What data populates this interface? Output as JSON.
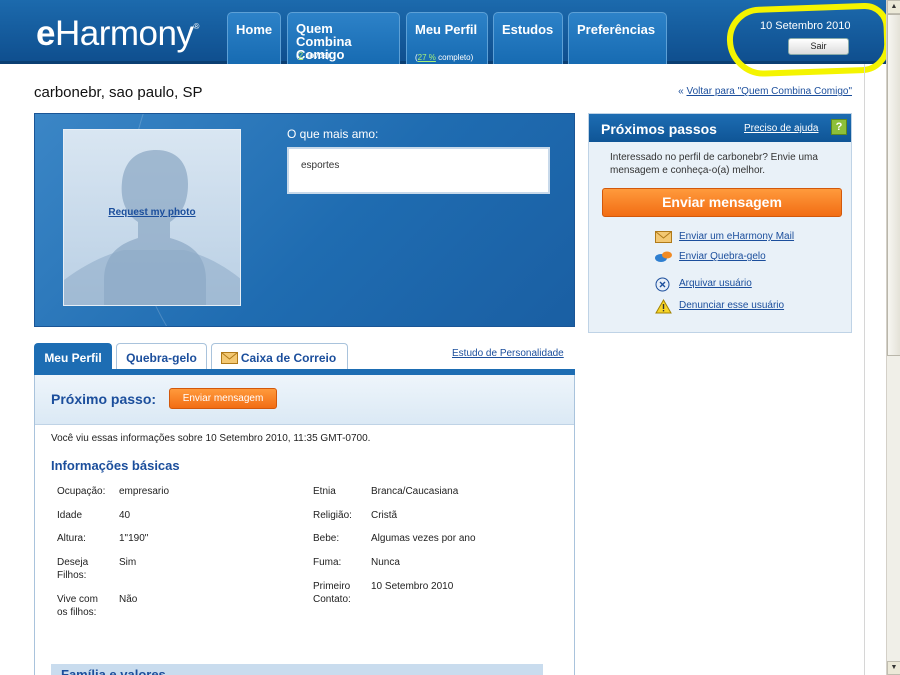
{
  "header": {
    "logo": {
      "e": "e",
      "rest": "Harmony",
      "tm": "®"
    },
    "nav": [
      {
        "label": "Home"
      },
      {
        "label": "Quem Combina Comigo",
        "sub_count": "2",
        "sub_text": " novos)"
      },
      {
        "label": "Meu Perfil",
        "sub_count": "27 %",
        "sub_text": " completo)"
      },
      {
        "label": "Estudos"
      },
      {
        "label": "Preferências"
      }
    ],
    "date": "10 Setembro 2010",
    "logout": "Sair"
  },
  "profile": {
    "title": "carbonebr, sao paulo, SP",
    "back_link_prefix": "« ",
    "back_link": "Voltar para \"Quem Combina Comigo\"",
    "photo_link": "Request my photo",
    "love_label": "O que mais amo:",
    "love_value": "esportes"
  },
  "next_steps": {
    "title": "Próximos passos",
    "help": "Preciso de ajuda",
    "help_icon": "?",
    "text": "Interessado no perfil de carbonebr? Envie uma mensagem e conheça-o(a) melhor.",
    "send_message": "Enviar mensagem",
    "actions": [
      {
        "icon": "mail-icon",
        "label": "Enviar um eHarmony Mail"
      },
      {
        "icon": "icebreaker-icon",
        "label": "Enviar Quebra-gelo"
      },
      {
        "icon": "archive-x-icon",
        "label": "Arquivar usuário"
      },
      {
        "icon": "warning-icon",
        "label": "Denunciar esse usuário"
      }
    ]
  },
  "tabs": [
    {
      "label": "Meu Perfil",
      "active": true
    },
    {
      "label": "Quebra-gelo"
    },
    {
      "label": "Caixa de Correio"
    }
  ],
  "personality_link": "Estudo de Personalidade",
  "main": {
    "next_label": "Próximo passo:",
    "send_message": "Enviar mensagem",
    "viewed_text": "Você viu essas informações sobre 10 Setembro 2010, 11:35 GMT-0700.",
    "basic_heading": "Informações básicas",
    "left_fields": [
      {
        "label": "Ocupação:",
        "value": "empresario"
      },
      {
        "label": "Idade",
        "value": "40"
      },
      {
        "label": "Altura:",
        "value": "1\"190\""
      },
      {
        "label": "Deseja Filhos:",
        "value": "Sim"
      },
      {
        "label": "Vive com os filhos:",
        "value": "Não"
      }
    ],
    "right_fields": [
      {
        "label": "Etnia",
        "value": "Branca/Caucasiana"
      },
      {
        "label": "Religião:",
        "value": "Cristã"
      },
      {
        "label": "Bebe:",
        "value": "Algumas vezes por ano"
      },
      {
        "label": "Fuma:",
        "value": "Nunca"
      },
      {
        "label": "Primeiro Contato:",
        "value": "10 Setembro 2010"
      }
    ],
    "family_heading": "Família e valores"
  },
  "colors": {
    "brand_blue": "#1d6db3",
    "orange": "#f26d14",
    "highlight": "#f4f400"
  }
}
